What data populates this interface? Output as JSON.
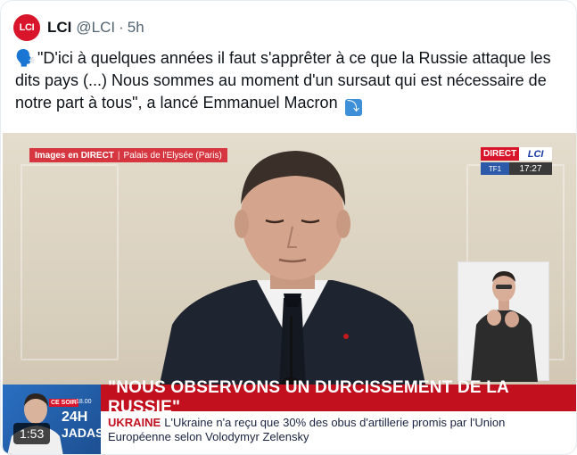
{
  "author": {
    "avatar_text": "LCI",
    "display_name": "LCI",
    "handle": "@LCI",
    "separator": "·",
    "time_ago": "5h"
  },
  "tweet": {
    "emoji": "🗣️",
    "text": "\"D'ici à quelques années il faut s'apprêter à ce que la Russie attaque les dits pays (...) Nous sommes au moment d'un sursaut qui est nécessaire de notre part à tous\", a lancé Emmanuel Macron",
    "arrow_emoji": "⤵"
  },
  "video": {
    "live_label": "Images en DIRECT",
    "separator": "|",
    "location": "Palais de l'Elysée (Paris)",
    "logo_direct": "DIRECT",
    "logo_lci": "LCI",
    "logo_tf1": "TF1",
    "clock": "17:27",
    "headline": "\"NOUS OBSERVONS UN DURCISSEMENT DE LA RUSSIE\"",
    "sub_tag": "UKRAINE",
    "sub_text": "L'Ukraine n'a reçu que 30% des obus d'artillerie promis par l'Union Européenne selon Volodymyr Zelensky",
    "promo_tag": "CE SOIR",
    "promo_time": "18.00",
    "promo_24": "24H",
    "promo_name": "JADAS",
    "duration": "1:53"
  },
  "colors": {
    "lci_red": "#d8152a",
    "headline_red": "#c2101f",
    "lci_blue": "#1b3aa6"
  }
}
